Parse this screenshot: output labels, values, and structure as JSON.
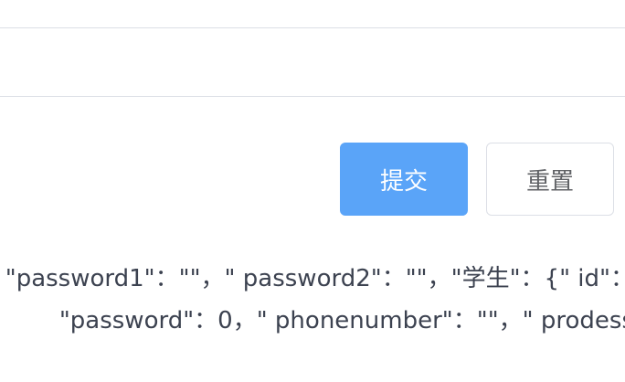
{
  "form": {
    "submit_label": "提交",
    "reset_label": "重置"
  },
  "output": {
    "lines": [
      "\"password1\"：\"\"，\" password2\"：\"\"，\"学生\"：{\" id\"：",
      "\"password\"：0，\" phonenumber\"：\"\"，\" prodess"
    ]
  },
  "colors": {
    "primary": "#5aa4f8",
    "border": "#dcdfe6",
    "text": "#3c4250"
  }
}
